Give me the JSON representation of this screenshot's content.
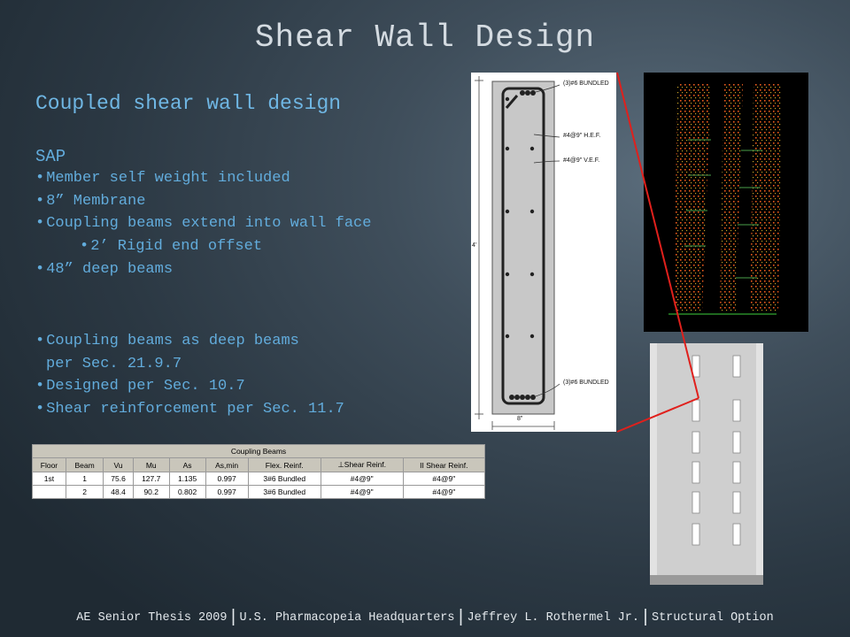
{
  "title": "Shear Wall Design",
  "subtitle": "Coupled shear wall design",
  "sap_heading": "SAP",
  "bullets_a": [
    "Member self weight included",
    "8” Membrane",
    "Coupling beams extend into wall face"
  ],
  "sub_bullet": "2’ Rigid end offset",
  "bullet_a4": "48” deep beams",
  "bullets_b": [
    "Coupling beams as deep beams",
    "Designed per Sec. 10.7",
    "Shear reinforcement per Sec. 11.7"
  ],
  "bullet_b1_cont": "per Sec. 21.9.7",
  "diagram": {
    "label_top": "(3)#6 BUNDLED",
    "label_hef": "#4@9\" H.E.F.",
    "label_vef": "#4@9\" V.E.F.",
    "label_bottom": "(3)#6 BUNDLED",
    "dim_height": "4'",
    "dim_width": "8\""
  },
  "table": {
    "caption": "Coupling Beams",
    "headers": [
      "Floor",
      "Beam",
      "Vu",
      "Mu",
      "As",
      "As,min",
      "Flex. Reinf.",
      "⊥Shear Reinf.",
      "II Shear Reinf."
    ],
    "rows": [
      [
        "1st",
        "1",
        "75.6",
        "127.7",
        "1.135",
        "0.997",
        "3#6 Bundled",
        "#4@9\"",
        "#4@9\""
      ],
      [
        "",
        "2",
        "48.4",
        "90.2",
        "0.802",
        "0.997",
        "3#6 Bundled",
        "#4@9\"",
        "#4@9\""
      ]
    ]
  },
  "footer": {
    "items": [
      "AE Senior Thesis 2009",
      "U.S. Pharmacopeia Headquarters",
      "Jeffrey L. Rothermel Jr.",
      "Structural Option"
    ],
    "separator": "|"
  },
  "colors": {
    "title": "#d4dbe1",
    "body_text": "#62acdc",
    "accent_line": "#e0201c"
  }
}
